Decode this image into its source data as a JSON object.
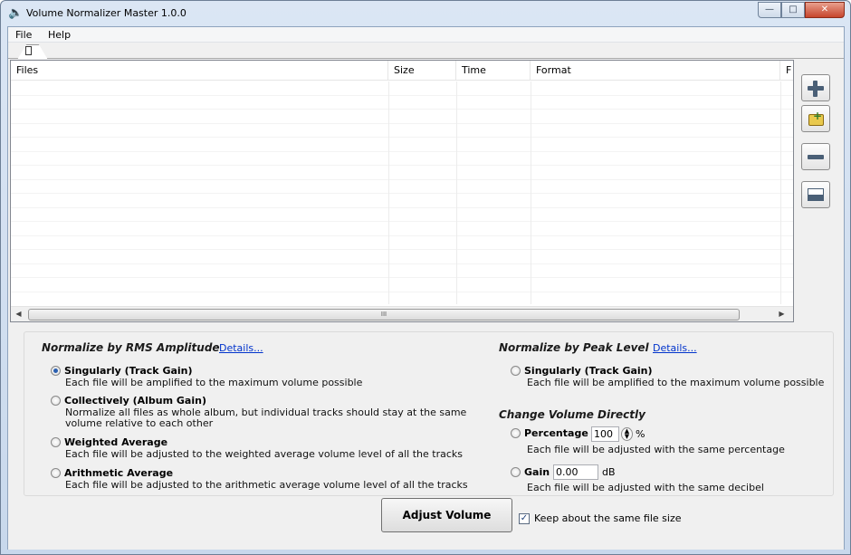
{
  "window": {
    "title": "Volume Normalizer Master 1.0.0"
  },
  "menu": {
    "items": [
      "File",
      "Help"
    ]
  },
  "list": {
    "columns": [
      "Files",
      "Size",
      "Time",
      "Format",
      "F"
    ],
    "rows": []
  },
  "normalize_rms": {
    "title": "Normalize by RMS Amplitude",
    "details": "Details...",
    "options": [
      {
        "label": "Singularly (Track Gain)",
        "desc": "Each file will be amplified to the maximum volume possible",
        "checked": true
      },
      {
        "label": "Collectively (Album Gain)",
        "desc": "Normalize all files as whole album, but individual tracks should stay at the same",
        "desc2": "volume relative to each other",
        "checked": false
      },
      {
        "label": "Weighted Average",
        "desc": "Each file will be adjusted to the weighted average volume level of all the tracks",
        "checked": false
      },
      {
        "label": "Arithmetic Average",
        "desc": "Each file will be adjusted to the arithmetic average volume level of all the tracks",
        "checked": false
      }
    ]
  },
  "normalize_peak": {
    "title": "Normalize by Peak Level",
    "details": "Details...",
    "option": {
      "label": "Singularly (Track Gain)",
      "desc": "Each file will be amplified to the maximum volume possible",
      "checked": false
    }
  },
  "change_volume": {
    "title": "Change Volume Directly",
    "percentage": {
      "label": "Percentage",
      "value": "100",
      "unit": "%",
      "desc": "Each file will be adjusted with the same percentage"
    },
    "gain": {
      "label": "Gain",
      "value": "0.00",
      "unit": "dB",
      "desc": "Each file will be adjusted with the same decibel"
    }
  },
  "footer": {
    "adjust_label": "Adjust Volume",
    "keep_size_label": "Keep about the same file size",
    "keep_size_checked": true
  },
  "scrollbar": {
    "grip": "III"
  }
}
